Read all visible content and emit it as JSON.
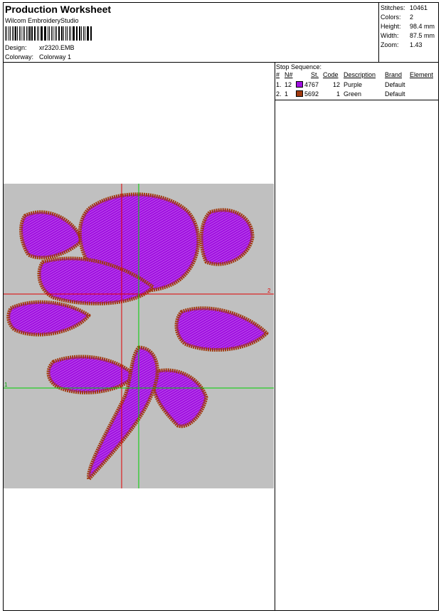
{
  "header": {
    "title": "Production Worksheet",
    "software": "Wilcom EmbroideryStudio",
    "design_label": "Design:",
    "design_value": "xr2320.EMB",
    "colorway_label": "Colorway:",
    "colorway_value": "Colorway 1"
  },
  "stats": [
    {
      "label": "Stitches:",
      "value": "10461"
    },
    {
      "label": "Colors:",
      "value": "2"
    },
    {
      "label": "Height:",
      "value": "98.4 mm"
    },
    {
      "label": "Width:",
      "value": "87.5 mm"
    },
    {
      "label": "Zoom:",
      "value": "1.43"
    }
  ],
  "stop_sequence": {
    "title": "Stop Sequence:",
    "columns": [
      "#",
      "N#",
      "St.",
      "Code",
      "Description",
      "Brand",
      "Element"
    ],
    "rows": [
      {
        "num": "1.",
        "n": "12",
        "color": "#a010e0",
        "st": "4767",
        "code": "12",
        "description": "Purple",
        "brand": "Default",
        "element": ""
      },
      {
        "num": "2.",
        "n": "1",
        "color": "#a03a10",
        "st": "5692",
        "code": "1",
        "description": "Green",
        "brand": "Default",
        "element": ""
      }
    ]
  },
  "preview": {
    "background": "#c0c0c0",
    "axis_red_label": "2",
    "axis_green_label": "1",
    "outline_color": "#a03a10",
    "fill_color": "#a010e0"
  }
}
